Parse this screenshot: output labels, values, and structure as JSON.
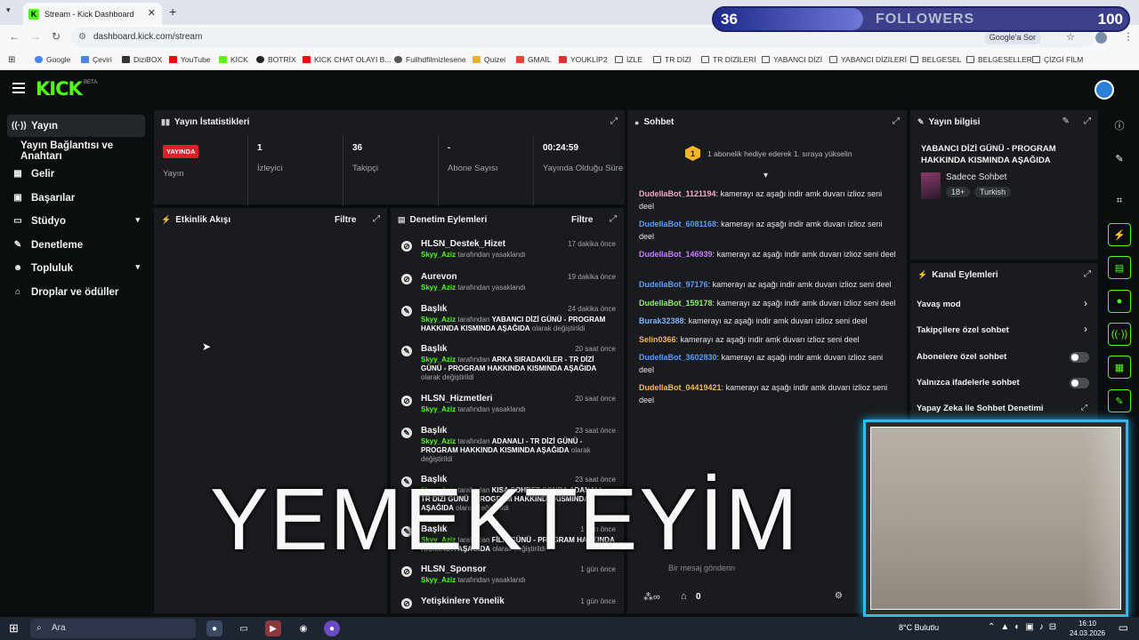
{
  "browser": {
    "tab_title": "Stream - Kick Dashboard",
    "url": "dashboard.kick.com/stream",
    "google_ask": "Google'a Sor",
    "bookmarks": [
      "Google",
      "Çeviri",
      "DiziBOX",
      "YouTube",
      "KİCK",
      "BOTRİX",
      "KİCK CHAT OLAYI B...",
      "Fullhdfilmizlesene",
      "Quizei",
      "GMAİL",
      "YOUKLİP2",
      "İZLE",
      "TR DİZİ",
      "TR DİZİLERİ",
      "YABANCI DİZİ",
      "YABANCI DİZİLERİ",
      "BELGESEL",
      "BELGESELLER",
      "ÇİZGİ FİLM"
    ]
  },
  "overlay": {
    "followers_current": "36",
    "followers_label": "FOLLOWERS",
    "followers_goal": "100",
    "followers_progress": 0.36,
    "big_text": "YEMEKTEYİM"
  },
  "sidebar": {
    "items": [
      {
        "label": "Yayın",
        "icon": "broadcast-icon"
      },
      {
        "label": "Yayın Bağlantısı ve Anahtarı"
      },
      {
        "label": "Gelir",
        "icon": "revenue-icon"
      },
      {
        "label": "Başarılar",
        "icon": "achievements-icon"
      },
      {
        "label": "Stüdyo",
        "icon": "studio-icon"
      },
      {
        "label": "Denetleme",
        "icon": "moderation-icon"
      },
      {
        "label": "Topluluk",
        "icon": "community-icon"
      },
      {
        "label": "Droplar ve ödüller",
        "icon": "drops-icon"
      }
    ]
  },
  "stats": {
    "title": "Yayın İstatistikleri",
    "live_badge": "YAYINDA",
    "live_label": "Yayın",
    "viewers_value": "1",
    "viewers_label": "İzleyici",
    "followers_value": "36",
    "followers_label": "Takipçi",
    "subs_value": "-",
    "subs_label": "Abone Sayısı",
    "duration_value": "00:24:59",
    "duration_label": "Yayında Olduğu Süre"
  },
  "activity": {
    "title": "Etkinlik Akışı",
    "filter": "Filtre"
  },
  "moderation": {
    "title": "Denetim Eylemleri",
    "filter": "Filtre",
    "entries": [
      {
        "name": "HLSN_Destek_Hizet",
        "time": "17 dakika önce",
        "user": "Skyy_Aziz",
        "pre": "tarafından yasaklandı",
        "title": "",
        "post": ""
      },
      {
        "name": "Aurevon",
        "time": "19 dakika önce",
        "user": "Skyy_Aziz",
        "pre": "tarafından yasaklandı",
        "title": "",
        "post": ""
      },
      {
        "name": "Başlık",
        "time": "24 dakika önce",
        "user": "Skyy_Aziz",
        "pre": "tarafından",
        "title": "YABANCI DİZİ GÜNÜ - PROGRAM HAKKINDA KISMINDA AŞAĞIDA",
        "post": "olarak değiştirildi"
      },
      {
        "name": "Başlık",
        "time": "20 saat önce",
        "user": "Skyy_Aziz",
        "pre": "tarafından",
        "title": "ARKA SIRADAKİLER - TR DİZİ GÜNÜ - PROGRAM HAKKINDA KISMINDA AŞAĞIDA",
        "post": "olarak değiştirildi"
      },
      {
        "name": "HLSN_Hizmetleri",
        "time": "20 saat önce",
        "user": "Skyy_Aziz",
        "pre": "tarafından yasaklandı",
        "title": "",
        "post": ""
      },
      {
        "name": "Başlık",
        "time": "23 saat önce",
        "user": "Skyy_Aziz",
        "pre": "tarafından",
        "title": "ADANALI - TR DİZİ GÜNÜ - PROGRAM HAKKINDA KISMINDA AŞAĞIDA",
        "post": "olarak değiştirildi"
      },
      {
        "name": "Başlık",
        "time": "23 saat önce",
        "user": "Skyy_Aziz",
        "pre": "tarafından",
        "title": "KISA SOHBET SONRA ADANALI - TR DİZİ GÜNÜ - PROGRAM HAKKINDA KISMINDA AŞAĞIDA",
        "post": "olarak değiştirildi"
      },
      {
        "name": "Başlık",
        "time": "1 gün önce",
        "user": "Skyy_Aziz",
        "pre": "tarafından",
        "title": "FİLM GÜNÜ - PROGRAM HAKKINDA KISMINDA AŞAĞIDA",
        "post": "olarak değiştirildi"
      },
      {
        "name": "HLSN_Sponsor",
        "time": "1 gün önce",
        "user": "Skyy_Aziz",
        "pre": "tarafından yasaklandı",
        "title": "",
        "post": ""
      },
      {
        "name": "Yetişkinlere Yönelik",
        "time": "1 gün önce",
        "user": "",
        "pre": "",
        "title": "",
        "post": ""
      }
    ]
  },
  "chat": {
    "title": "Sohbet",
    "gift_text": "1 abonelik hediye ederek 1. sıraya yükselin",
    "gift_count": "1",
    "input_placeholder": "Bir mesaj gönderin",
    "online_count": "0",
    "messages": [
      {
        "user": "DudellaBot_1121194",
        "color": "#f2a6c9",
        "text": "kamerayı az aşağı indir amk duvarı izlioz seni deel"
      },
      {
        "user": "DudellaBot_6081168",
        "color": "#5b9cff",
        "text": "kamerayı az aşağı indir amk duvarı izlioz seni deel"
      },
      {
        "user": "DudellaBot_146939",
        "color": "#c77dff",
        "text": "kamerayı az aşağı indir amk duvarı izlioz seni deel"
      },
      {
        "user": "DudellaBot_97176",
        "color": "#5b9cff",
        "text": "kamerayı az aşağı indir amk duvarı izlioz seni deel"
      },
      {
        "user": "DudellaBot_159178",
        "color": "#8cf06b",
        "text": "kamerayı az aşağı indir amk duvarı izlioz seni deel"
      },
      {
        "user": "Burak32388",
        "color": "#7fb2ff",
        "text": "kamerayı az aşağı indir amk duvarı izlioz seni deel"
      },
      {
        "user": "Selin0366",
        "color": "#f5b95a",
        "text": "kamerayı az aşağı indir amk duvarı izlioz seni deel"
      },
      {
        "user": "DudellaBot_3602830",
        "color": "#5b9cff",
        "text": "kamerayı az aşağı indir amk duvarı izlioz seni deel"
      },
      {
        "user": "DudellaBot_04419421",
        "color": "#f5b95a",
        "text": "kamerayı az aşağı indir amk duvarı izlioz seni deel"
      }
    ]
  },
  "info": {
    "title": "Yayın bilgisi",
    "stream_title": "YABANCI DİZİ GÜNÜ - PROGRAM HAKKINDA KISMINDA AŞAĞIDA",
    "category": "Sadece Sohbet",
    "tag1": "18+",
    "tag2": "Turkish"
  },
  "channel_actions": {
    "title": "Kanal Eylemleri",
    "slow_mode": "Yavaş mod",
    "followers_only": "Takipçilere özel sohbet",
    "subs_only": "Abonelere özel sohbet",
    "emotes_only": "Yalnızca ifadelerle sohbet",
    "ai_moderation": "Yapay Zeka ile Sohbet Denetimi"
  },
  "taskbar": {
    "search_placeholder": "Ara",
    "weather": "8°C  Bulutlu",
    "time": "16:10",
    "date": "24.03.2026"
  },
  "colors": {
    "kick_green": "#53fc18",
    "live_red": "#e11d27",
    "panel_bg": "#191b1f",
    "page_bg": "#0b0e0f"
  }
}
